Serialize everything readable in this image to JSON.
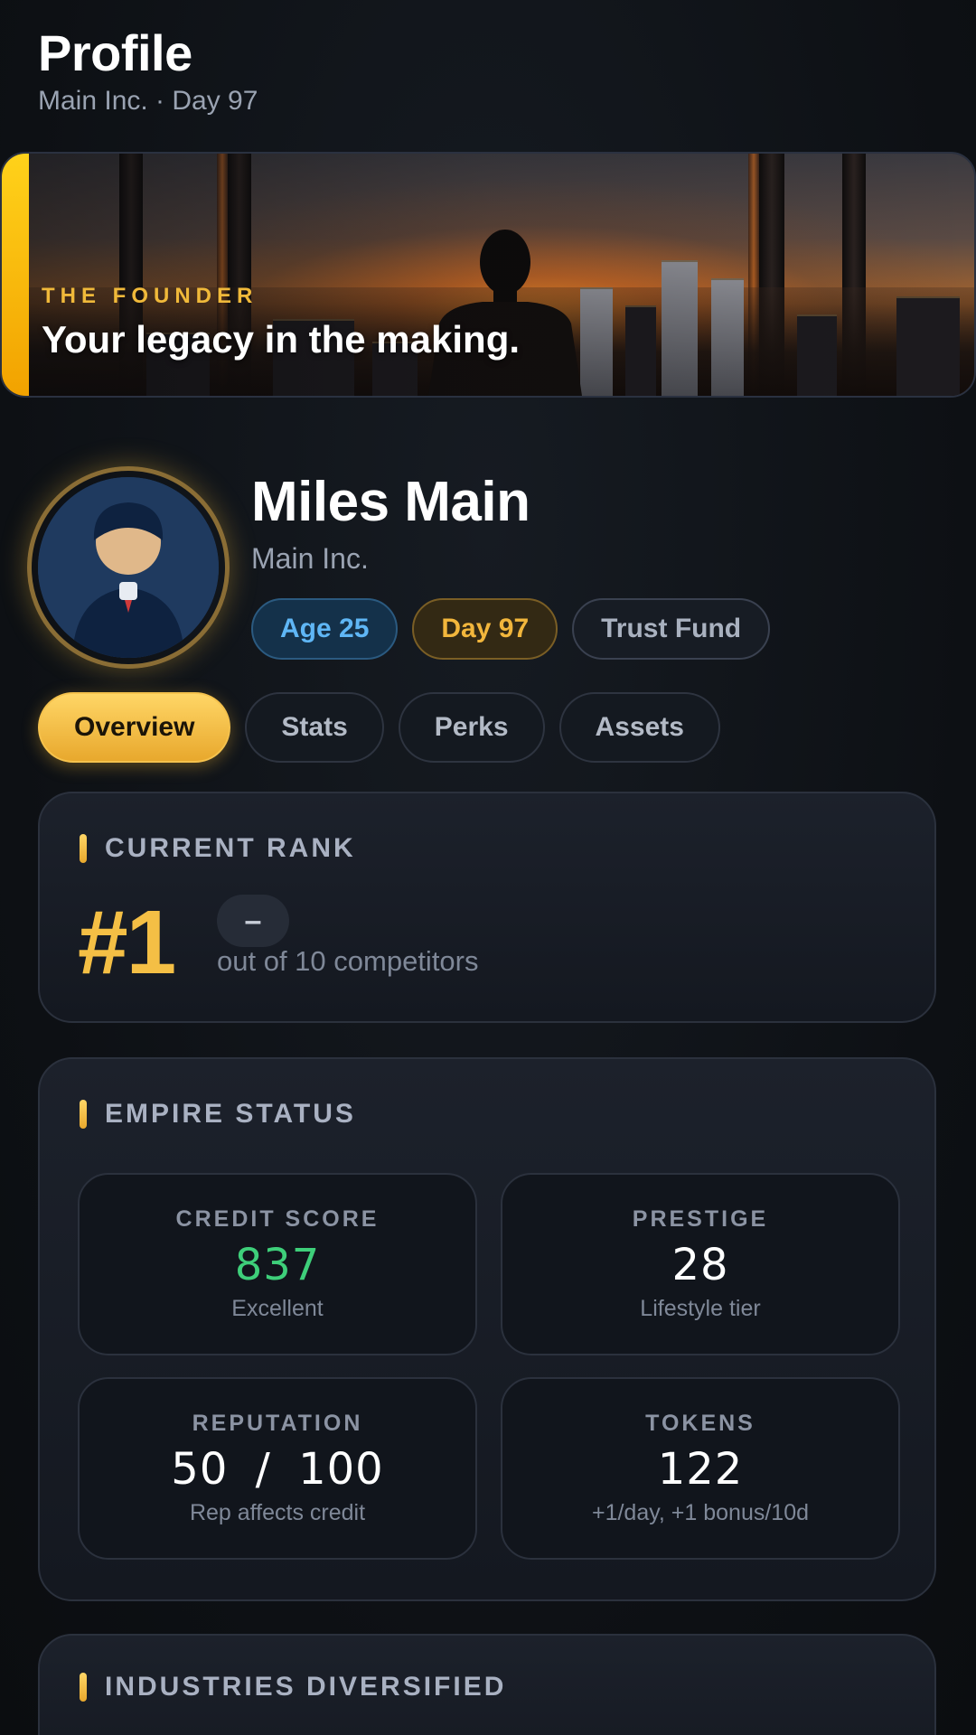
{
  "header": {
    "title": "Profile",
    "subtitle": "Main Inc. · Day 97"
  },
  "hero": {
    "kicker": "THE FOUNDER",
    "tagline": "Your legacy in the making.",
    "image": "city-skyline-silhouette"
  },
  "profile": {
    "name": "Miles Main",
    "company": "Main Inc.",
    "avatar": "founder-avatar",
    "chips": {
      "age": "Age 25",
      "day": "Day 97",
      "background": "Trust Fund"
    }
  },
  "tabs": [
    {
      "label": "Overview",
      "active": true
    },
    {
      "label": "Stats",
      "active": false
    },
    {
      "label": "Perks",
      "active": false
    },
    {
      "label": "Assets",
      "active": false
    }
  ],
  "rank": {
    "title": "CURRENT RANK",
    "value": "#1",
    "delta": "–",
    "subtitle": "out of 10 competitors"
  },
  "empire": {
    "title": "EMPIRE STATUS",
    "stats": [
      {
        "label": "CREDIT SCORE",
        "value": "837",
        "note": "Excellent"
      },
      {
        "label": "PRESTIGE",
        "value": "28",
        "note": "Lifestyle tier"
      },
      {
        "label": "REPUTATION",
        "value": "50 / 100",
        "note": "Rep affects credit"
      },
      {
        "label": "TOKENS",
        "value": "122",
        "note": "+1/day, +1 bonus/10d"
      }
    ]
  },
  "industries": {
    "title": "INDUSTRIES DIVERSIFIED"
  },
  "colors": {
    "accent": "#f4bf45",
    "good": "#3ecf7a",
    "info": "#5fb6f5",
    "background": "#0d1014"
  }
}
